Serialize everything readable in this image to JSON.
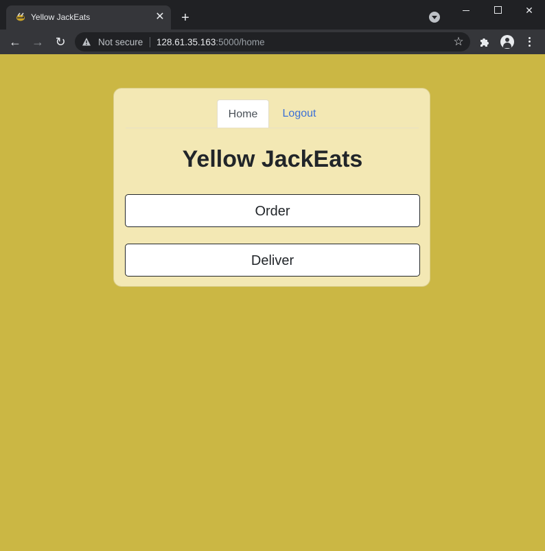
{
  "browser": {
    "tab_title": "Yellow JackEats",
    "tab_close_icon": "close-icon",
    "new_tab_icon": "plus-icon",
    "security_label": "Not secure",
    "url_host": "128.61.35.163",
    "url_rest": ":5000/home",
    "icons": {
      "back": "arrow-left-icon",
      "forward": "arrow-right-icon",
      "reload": "reload-icon",
      "warning": "warning-icon",
      "bookmark": "star-icon",
      "extensions": "puzzle-icon",
      "profile": "profile-icon",
      "menu": "kebab-menu-icon"
    }
  },
  "page": {
    "background": "#cbb744",
    "card_background": "#f3e8b4",
    "nav": [
      {
        "label": "Home",
        "active": true
      },
      {
        "label": "Logout",
        "active": false
      }
    ],
    "title": "Yellow JackEats",
    "buttons": {
      "order": "Order",
      "deliver": "Deliver"
    }
  }
}
